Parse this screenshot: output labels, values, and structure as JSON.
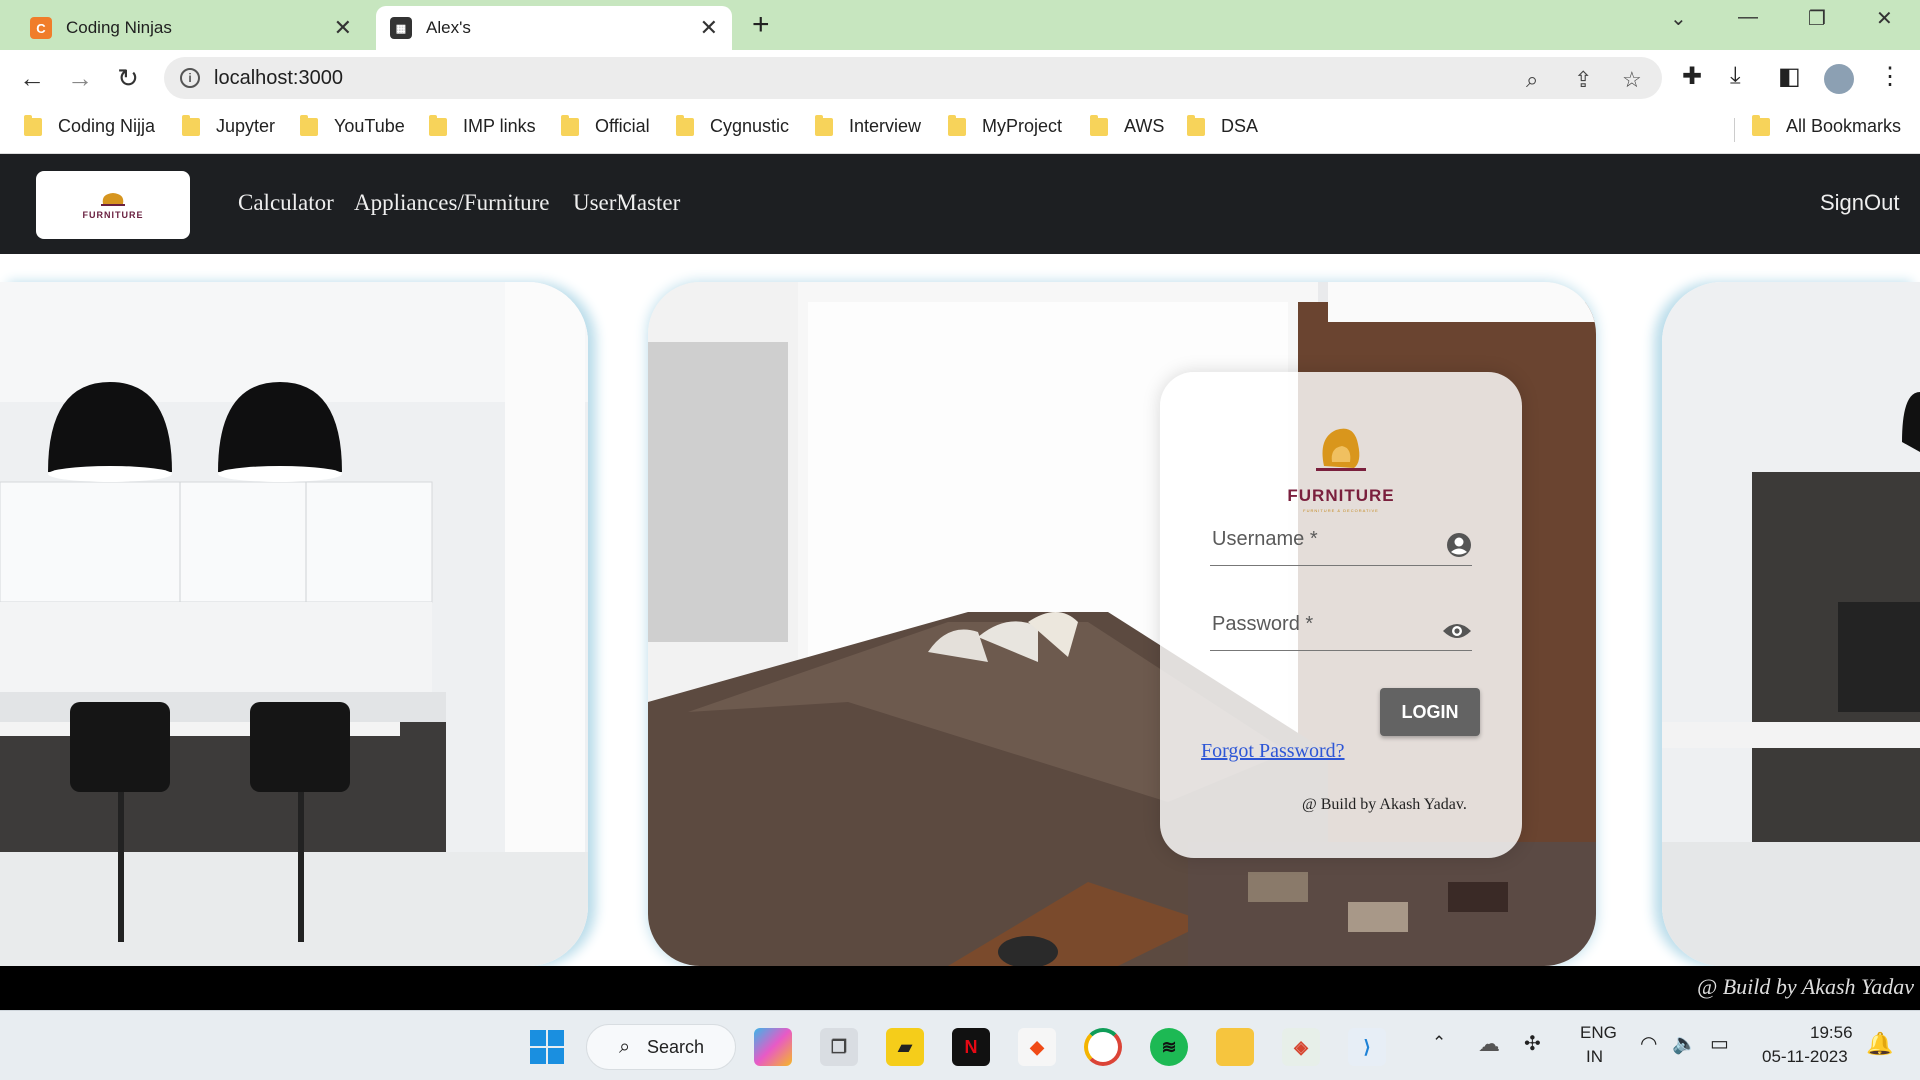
{
  "browser": {
    "tabs": [
      {
        "title": "Coding Ninjas",
        "icon": "coding-ninjas-icon"
      },
      {
        "title": "Alex's",
        "icon": "calculator-icon"
      }
    ],
    "new_tab": "+",
    "url": "localhost:3000",
    "bookmarks": [
      "Coding Nijja",
      "Jupyter",
      "YouTube",
      "IMP links",
      "Official",
      "Cygnustic",
      "Interview",
      "MyProject",
      "AWS",
      "DSA"
    ],
    "all_bookmarks": "All Bookmarks"
  },
  "app": {
    "brand": "FURNITURE",
    "nav": [
      "Calculator",
      "Appliances/Furniture",
      "UserMaster"
    ],
    "signout": "SignOut",
    "login": {
      "brand": "FURNITURE",
      "brand_sub": "FURNITURE & DECORATIVE",
      "username_label": "Username *",
      "password_label": "Password *",
      "login_button": "LOGIN",
      "forgot": "Forgot Password?",
      "credit": "@ Build by Akash Yadav."
    },
    "footer": "@ Build by Akash Yadav"
  },
  "taskbar": {
    "search": "Search",
    "lang1": "ENG",
    "lang2": "IN",
    "time": "19:56",
    "date": "05-11-2023"
  },
  "colors": {
    "tabstrip": "#c7e6bf",
    "navbar": "#1d1f22",
    "footer": "#000000",
    "login_button": "#636363",
    "link": "#2d56d6"
  }
}
